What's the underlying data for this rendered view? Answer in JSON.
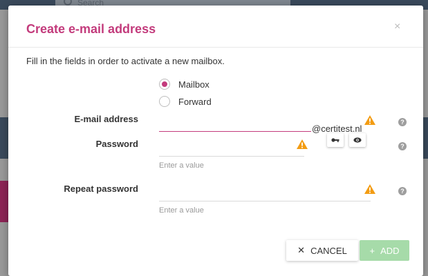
{
  "background": {
    "search_placeholder": "Search"
  },
  "dialog": {
    "title": "Create e-mail address",
    "close_symbol": "×",
    "intro": "Fill in the fields in order to activate a new mailbox.",
    "type_options": [
      {
        "label": "Mailbox",
        "selected": true
      },
      {
        "label": "Forward",
        "selected": false
      }
    ],
    "email": {
      "label": "E-mail address",
      "value": "",
      "domain": "@certitest.nl"
    },
    "password": {
      "label": "Password",
      "value": "",
      "hint": "Enter a value"
    },
    "repeat_password": {
      "label": "Repeat password",
      "value": "",
      "hint": "Enter a value"
    },
    "help_symbol": "?",
    "buttons": {
      "cancel_symbol": "✕",
      "cancel_label": "CANCEL",
      "add_symbol": "+",
      "add_label": "ADD"
    }
  },
  "colors": {
    "accent": "#c33b7c",
    "warning": "#f39c12",
    "add_disabled": "#a6dba9",
    "help": "#9e9e9e"
  },
  "icons": [
    "close-icon",
    "warning-icon",
    "help-icon",
    "key-icon",
    "eye-icon",
    "cancel-icon",
    "plus-icon"
  ]
}
